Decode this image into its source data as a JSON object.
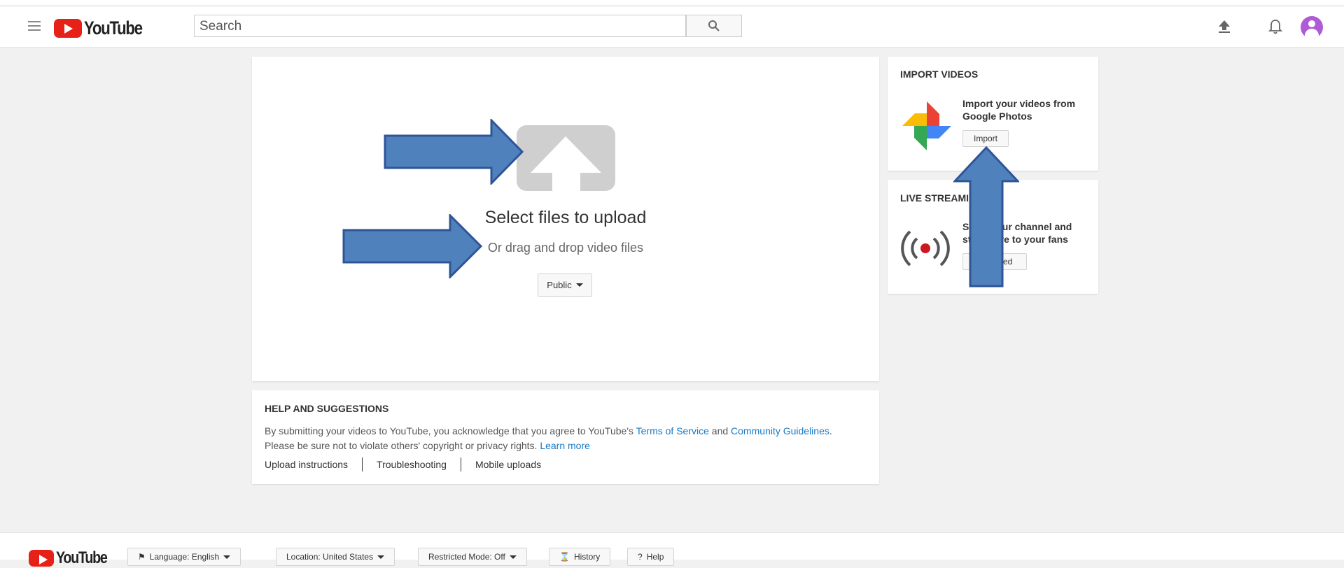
{
  "header": {
    "logo_text": "YouTube",
    "search_placeholder": "Search"
  },
  "upload": {
    "title": "Select files to upload",
    "subtitle": "Or drag and drop video files",
    "privacy_label": "Public"
  },
  "help": {
    "title": "HELP AND SUGGESTIONS",
    "text_before": "By submitting your videos to YouTube, you acknowledge that you agree to YouTube's ",
    "terms_link": "Terms of Service",
    "text_and": " and ",
    "guidelines_link": "Community Guidelines",
    "text_after": ".",
    "text_line2": "Please be sure not to violate others' copyright or privacy rights. ",
    "learn_more": "Learn more",
    "links": [
      "Upload instructions",
      "Troubleshooting",
      "Mobile uploads"
    ]
  },
  "import_videos": {
    "title": "IMPORT VIDEOS",
    "description": "Import your videos from Google Photos",
    "button": "Import"
  },
  "live_streaming": {
    "title": "LIVE STREAMIN",
    "description_line1": "S          our channel and",
    "description_line2": "st          ve to your fans",
    "button": "         rted"
  },
  "footer": {
    "logo_text": "YouTube",
    "language": "Language: English",
    "location": "Location: United States",
    "restricted": "Restricted Mode: Off",
    "history": "History",
    "help": "Help"
  },
  "colors": {
    "accent_link": "#167ac6",
    "youtube_red": "#e62117",
    "annotation_arrow": "#4f81bd"
  },
  "icons": {
    "menu": "hamburger-icon",
    "search": "search-icon",
    "upload": "upload-icon",
    "notifications": "bell-icon",
    "account": "avatar",
    "photos": "google-photos-icon",
    "live": "live-broadcast-icon"
  }
}
